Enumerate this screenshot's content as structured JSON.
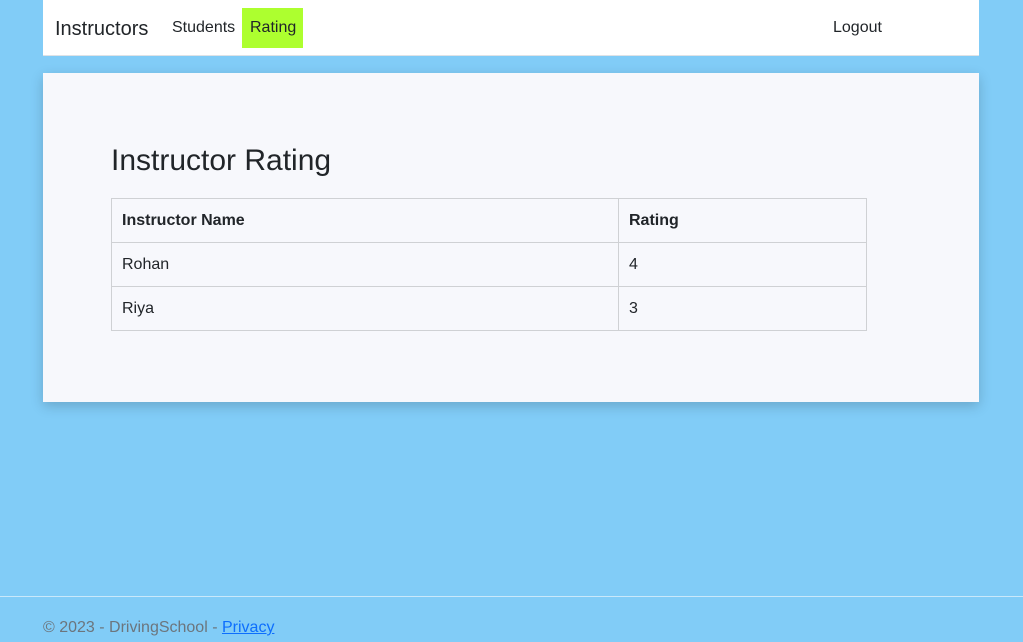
{
  "navbar": {
    "brand": "Instructors",
    "links": [
      {
        "label": "Students",
        "active": false
      },
      {
        "label": "Rating",
        "active": true
      }
    ],
    "logout_label": "Logout",
    "active_color": "#adff2f"
  },
  "main": {
    "title": "Instructor Rating",
    "table": {
      "headers": [
        "Instructor Name",
        "Rating"
      ],
      "rows": [
        [
          "Rohan",
          "4"
        ],
        [
          "Riya",
          "3"
        ]
      ]
    }
  },
  "footer": {
    "copyright": "© 2023 - DrivingSchool - ",
    "privacy_label": "Privacy"
  },
  "colors": {
    "background": "#81ccf7",
    "card": "#f7f8fc",
    "link": "#0d6efd"
  }
}
